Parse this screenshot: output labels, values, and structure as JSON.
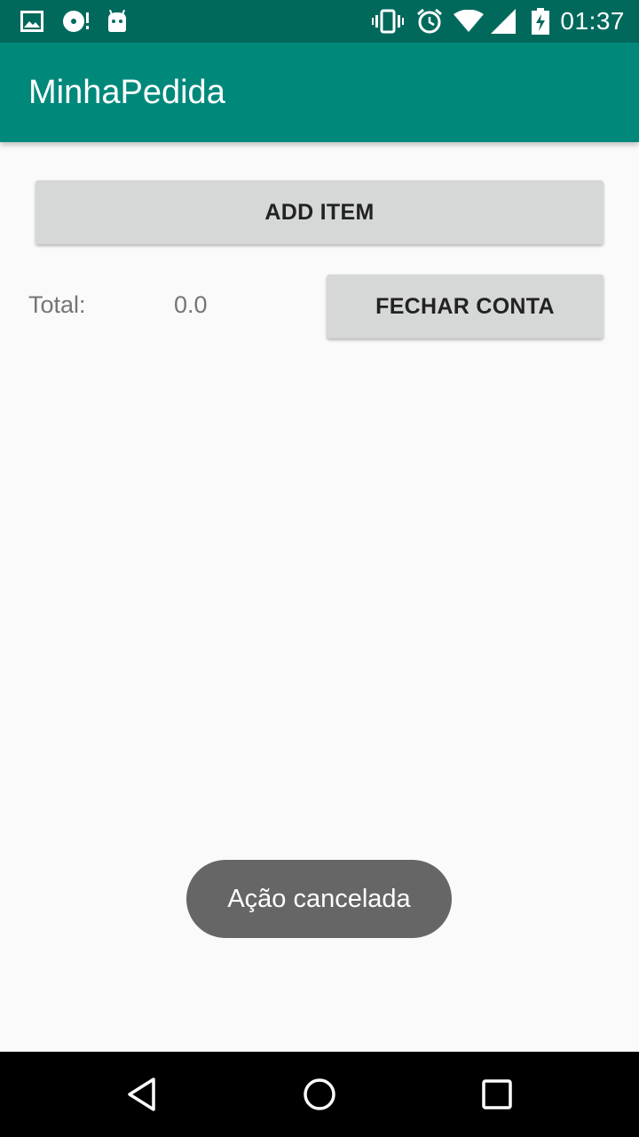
{
  "status_bar": {
    "time": "01:37",
    "icons": [
      "image-icon",
      "disc-icon",
      "android-icon",
      "vibrate-icon",
      "alarm-icon",
      "wifi-icon",
      "signal-icon",
      "battery-charging-icon"
    ]
  },
  "app_bar": {
    "title": "MinhaPedida"
  },
  "main": {
    "add_item_label": "ADD ITEM",
    "total_label": "Total:",
    "total_value": "0.0",
    "close_account_label": "FECHAR CONTA"
  },
  "toast": {
    "message": "Ação cancelada"
  },
  "nav_bar": {
    "icons": [
      "back-icon",
      "home-icon",
      "recents-icon"
    ]
  },
  "colors": {
    "status_bar": "#00695c",
    "app_bar": "#00897b",
    "button": "#d6d7d7",
    "toast": "#666666",
    "nav_bar": "#000000"
  }
}
